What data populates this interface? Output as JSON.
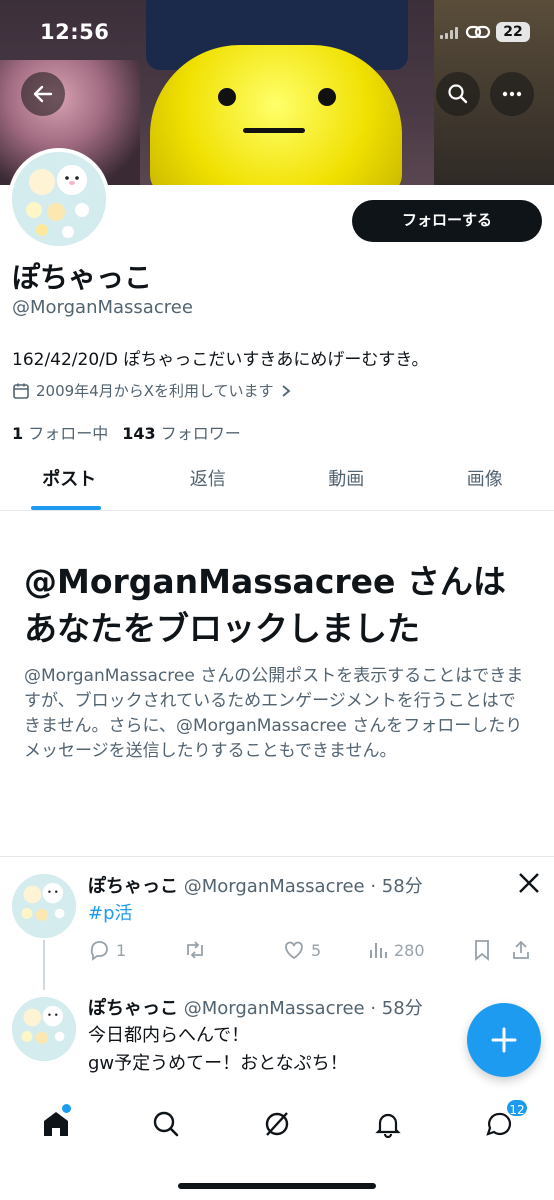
{
  "status_bar": {
    "time": "12:56",
    "battery": "22"
  },
  "profile": {
    "follow_label": "フォローする",
    "name": "ぽちゃっこ",
    "handle": "@MorganMassacree",
    "bio": "162/42/20/D ぽちゃっこだいすきあにめげーむすき。",
    "joined": "2009年4月からXを利用しています",
    "following_count": "1",
    "following_label": "フォロー中",
    "followers_count": "143",
    "followers_label": "フォロワー"
  },
  "tabs": [
    {
      "label": "ポスト"
    },
    {
      "label": "返信"
    },
    {
      "label": "動画"
    },
    {
      "label": "画像"
    }
  ],
  "blocked": {
    "title": "@MorganMassacree さんはあなたをブロックしました",
    "description": "@MorganMassacree さんの公開ポストを表示することはできますが、ブロックされているためエンゲージメントを行うことはできません。さらに、@MorganMassacree さんをフォローしたりメッセージを送信したりすることもできません。"
  },
  "posts": [
    {
      "name": "ぽちゃっこ",
      "meta": "@MorganMassacree · 58分",
      "hashtag": "#p活",
      "replies": "1",
      "likes": "5",
      "views": "280"
    },
    {
      "name": "ぽちゃっこ",
      "meta": "@MorganMassacree · 58分",
      "line1": "今日都内らへんで！",
      "line2": "gw予定うめてー！おとなぷち！"
    }
  ],
  "nav": {
    "messages_badge": "12"
  },
  "colors": {
    "accent": "#1d9bf0",
    "text": "#0f1419",
    "muted": "#536471"
  }
}
